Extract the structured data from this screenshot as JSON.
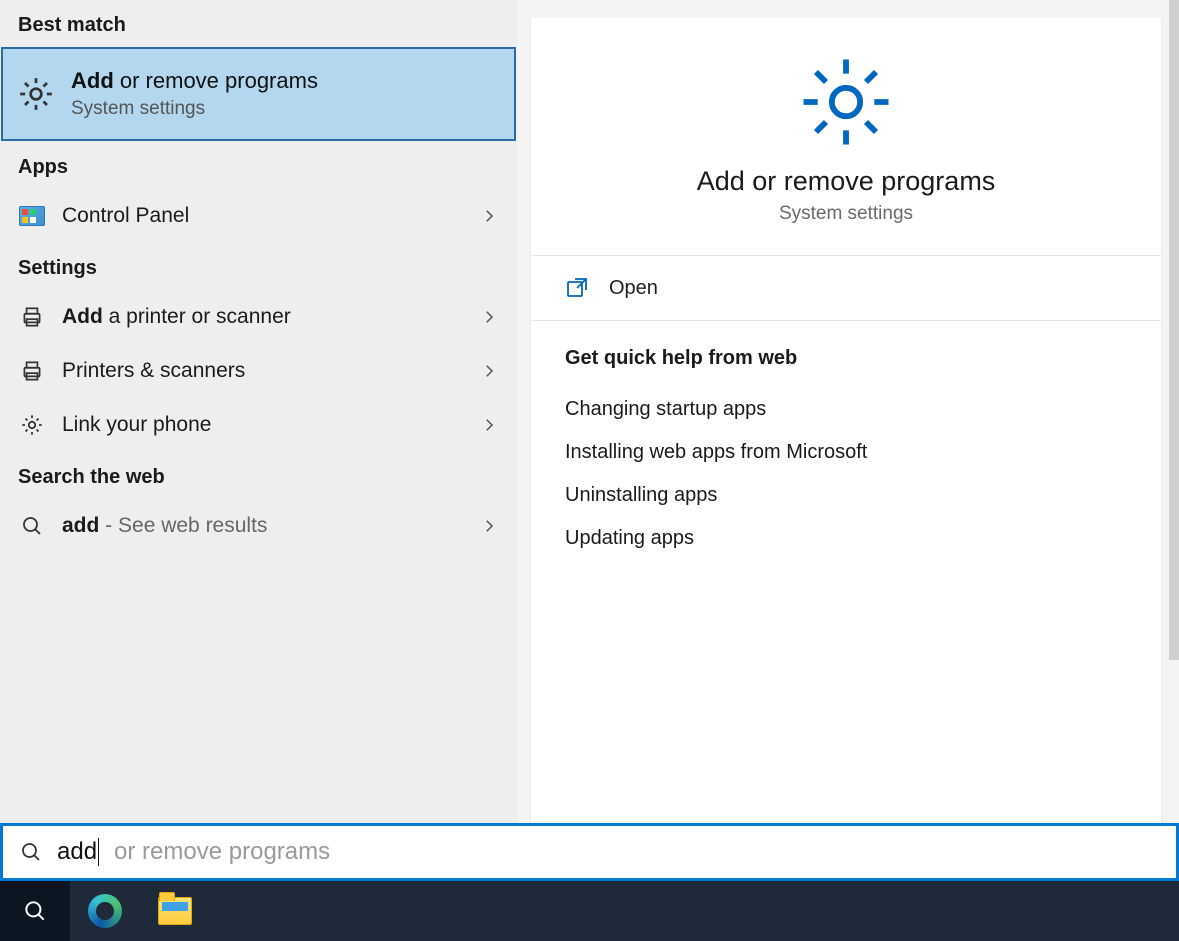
{
  "left": {
    "best_match_header": "Best match",
    "best_match": {
      "bold": "Add",
      "rest": " or remove programs",
      "subtitle": "System settings"
    },
    "apps_header": "Apps",
    "apps": [
      {
        "label": "Control Panel"
      }
    ],
    "settings_header": "Settings",
    "settings": [
      {
        "bold": "Add",
        "rest": " a printer or scanner"
      },
      {
        "bold": "",
        "rest": "Printers & scanners"
      },
      {
        "bold": "",
        "rest": "Link your phone"
      }
    ],
    "web_header": "Search the web",
    "web": {
      "bold": "add",
      "suffix": " - See web results"
    }
  },
  "right": {
    "title": "Add or remove programs",
    "subtitle": "System settings",
    "open_label": "Open",
    "help_title": "Get quick help from web",
    "help_links": [
      "Changing startup apps",
      "Installing web apps from Microsoft",
      "Uninstalling apps",
      "Updating apps"
    ]
  },
  "search": {
    "typed": "add",
    "suggestion": " or remove programs"
  }
}
